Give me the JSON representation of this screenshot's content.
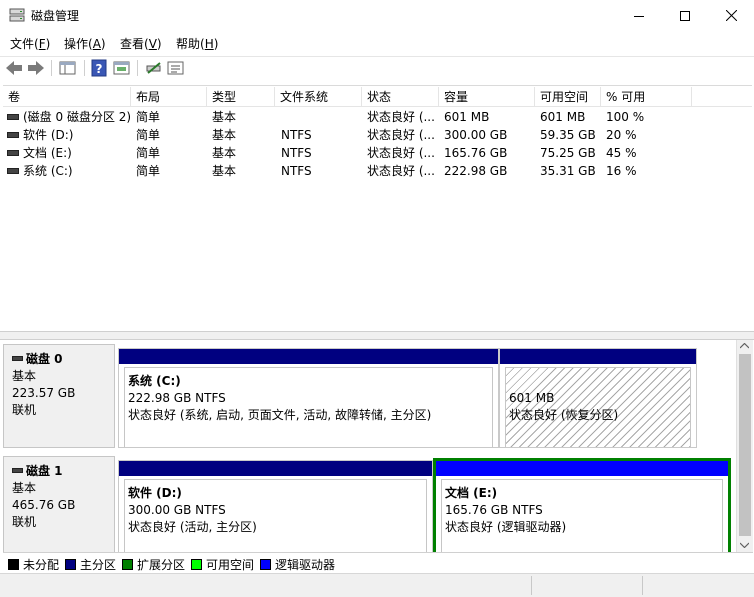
{
  "window": {
    "title": "磁盘管理",
    "controls": [
      "minimize",
      "maximize",
      "close"
    ]
  },
  "menu": [
    {
      "label": "文件(",
      "key": "F",
      "tail": ")"
    },
    {
      "label": "操作(",
      "key": "A",
      "tail": ")"
    },
    {
      "label": "查看(",
      "key": "V",
      "tail": ")"
    },
    {
      "label": "帮助(",
      "key": "H",
      "tail": ")"
    }
  ],
  "toolbar": {
    "icons": [
      "back-icon",
      "forward-icon",
      "console-tree-icon",
      "help-icon",
      "properties-icon",
      "connect-icon",
      "rescan-icon"
    ]
  },
  "volumes": {
    "columns": [
      "卷",
      "布局",
      "类型",
      "文件系统",
      "状态",
      "容量",
      "可用空间",
      "% 可用"
    ],
    "rows": [
      [
        "(磁盘 0 磁盘分区 2)",
        "简单",
        "基本",
        "",
        "状态良好 (...",
        "601 MB",
        "601 MB",
        "100 %"
      ],
      [
        "软件 (D:)",
        "简单",
        "基本",
        "NTFS",
        "状态良好 (...",
        "300.00 GB",
        "59.35 GB",
        "20 %"
      ],
      [
        "文档 (E:)",
        "简单",
        "基本",
        "NTFS",
        "状态良好 (...",
        "165.76 GB",
        "75.25 GB",
        "45 %"
      ],
      [
        "系统 (C:)",
        "简单",
        "基本",
        "NTFS",
        "状态良好 (...",
        "222.98 GB",
        "35.31 GB",
        "16 %"
      ]
    ]
  },
  "disks": [
    {
      "name": "磁盘 0",
      "type": "基本",
      "size": "223.57 GB",
      "status": "联机",
      "partitions": [
        {
          "name": "系统  (C:)",
          "size": "222.98 GB NTFS",
          "status": "状态良好 (系统, 启动, 页面文件, 活动, 故障转储, 主分区)",
          "kind": "primary"
        },
        {
          "name": "",
          "size": "601 MB",
          "status": "状态良好 (恢复分区)",
          "kind": "primary"
        }
      ]
    },
    {
      "name": "磁盘 1",
      "type": "基本",
      "size": "465.76 GB",
      "status": "联机",
      "partitions": [
        {
          "name": "软件  (D:)",
          "size": "300.00 GB NTFS",
          "status": "状态良好 (活动, 主分区)",
          "kind": "primary"
        },
        {
          "name": "文档  (E:)",
          "size": "165.76 GB NTFS",
          "status": "状态良好 (逻辑驱动器)",
          "kind": "logical"
        }
      ]
    }
  ],
  "legend": [
    {
      "label": "未分配",
      "color": "#000000"
    },
    {
      "label": "主分区",
      "color": "#000080"
    },
    {
      "label": "扩展分区",
      "color": "#008000"
    },
    {
      "label": "可用空间",
      "color": "#00ff00"
    },
    {
      "label": "逻辑驱动器",
      "color": "#0000ff"
    }
  ],
  "colors": {
    "primary": "#000080",
    "logical": "#0000ff",
    "extended": "#008000"
  }
}
